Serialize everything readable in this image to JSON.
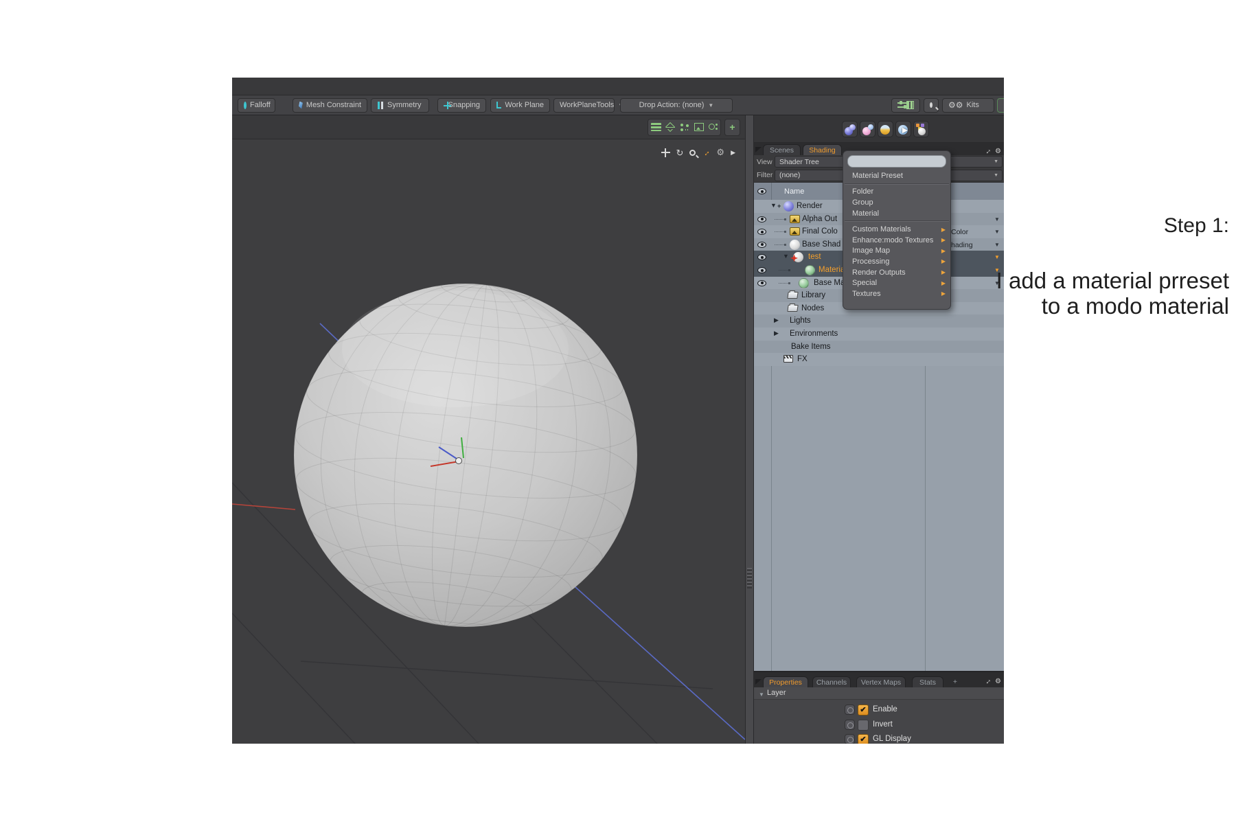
{
  "annotation": {
    "step": "Step 1:",
    "line1": "I add a material prreset",
    "line2": "to a modo material"
  },
  "toolbar": {
    "buttons": [
      {
        "label": "Falloff",
        "icon": "falloff-icon"
      },
      {
        "label": "Mesh Constraint",
        "icon": "mesh-constraint-icon"
      },
      {
        "label": "Symmetry",
        "icon": "symmetry-icon"
      },
      {
        "label": "Snapping",
        "icon": "snapping-icon"
      },
      {
        "label": "Work Plane",
        "icon": "work-plane-icon"
      },
      {
        "label": "WorkPlaneTools",
        "icon": "none"
      }
    ],
    "drop_action_label": "Drop Action: (none)",
    "kits_label": "Kits"
  },
  "shading_panel": {
    "tabs": [
      {
        "label": "Scenes",
        "active": false
      },
      {
        "label": "Shading",
        "active": true
      }
    ],
    "view_label": "View",
    "view_value": "Shader Tree",
    "filter_label": "Filter",
    "filter_value": "(none)",
    "name_column": "Name",
    "tree": [
      {
        "label": "Render",
        "icon": "sphere-purple",
        "eye": false,
        "expander": "down-plus",
        "selected": false,
        "effect": "",
        "effect_arrow": false
      },
      {
        "label": "Alpha Out",
        "icon": "image-map",
        "eye": true,
        "expander": "none",
        "selected": false,
        "effect": "",
        "effect_arrow": true
      },
      {
        "label": "Final Colo",
        "icon": "image-map",
        "eye": true,
        "expander": "none",
        "selected": false,
        "effect": "Color",
        "effect_arrow": true
      },
      {
        "label": "Base Shad",
        "icon": "sphere-white",
        "eye": true,
        "expander": "none",
        "selected": false,
        "effect": "hading",
        "effect_arrow": true
      },
      {
        "label": "test",
        "icon": "sphere-star",
        "eye": true,
        "expander": "down",
        "selected": true,
        "effect": "",
        "effect_arrow": true
      },
      {
        "label": "Materia",
        "icon": "sphere-green",
        "eye": true,
        "expander": "none",
        "selected": true,
        "effect": "",
        "effect_arrow": true
      },
      {
        "label": "Base Mate",
        "icon": "sphere-green",
        "eye": true,
        "expander": "none",
        "selected": false,
        "effect": "",
        "effect_arrow": true
      },
      {
        "label": "Library",
        "icon": "folder",
        "eye": false,
        "expander": "none",
        "selected": false,
        "effect": "",
        "effect_arrow": false
      },
      {
        "label": "Nodes",
        "icon": "folder",
        "eye": false,
        "expander": "none",
        "selected": false,
        "effect": "",
        "effect_arrow": false
      },
      {
        "label": "Lights",
        "icon": "none",
        "eye": false,
        "expander": "right",
        "selected": false,
        "effect": "",
        "effect_arrow": false
      },
      {
        "label": "Environments",
        "icon": "none",
        "eye": false,
        "expander": "right",
        "selected": false,
        "effect": "",
        "effect_arrow": false
      },
      {
        "label": "Bake Items",
        "icon": "none",
        "eye": false,
        "expander": "none",
        "selected": false,
        "effect": "",
        "effect_arrow": false
      },
      {
        "label": "FX",
        "icon": "clapperboard",
        "eye": false,
        "expander": "none",
        "selected": false,
        "effect": "",
        "effect_arrow": false
      }
    ]
  },
  "add_layer_menu": {
    "search_value": "",
    "items": [
      {
        "label": "Material Preset",
        "submenu": false
      },
      {
        "separator": true
      },
      {
        "label": "Folder",
        "submenu": false
      },
      {
        "label": "Group",
        "submenu": false
      },
      {
        "label": "Material",
        "submenu": false
      },
      {
        "separator": true
      },
      {
        "label": "Custom Materials",
        "submenu": true
      },
      {
        "label": "Enhance:modo Textures",
        "submenu": true
      },
      {
        "label": "Image Map",
        "submenu": true
      },
      {
        "label": "Processing",
        "submenu": true
      },
      {
        "label": "Render Outputs",
        "submenu": true
      },
      {
        "label": "Special",
        "submenu": true
      },
      {
        "label": "Textures",
        "submenu": true
      }
    ]
  },
  "properties_panel": {
    "tabs": [
      {
        "label": "Properties",
        "active": true
      },
      {
        "label": "Channels",
        "active": false
      },
      {
        "label": "Vertex Maps",
        "active": false
      },
      {
        "label": "Stats",
        "active": false
      },
      {
        "label": "+",
        "active": false
      }
    ],
    "section": "Layer",
    "rows": [
      {
        "label": "Enable",
        "checked": true
      },
      {
        "label": "Invert",
        "checked": false
      },
      {
        "label": "GL Display",
        "checked": true
      }
    ]
  },
  "colors": {
    "accent_orange": "#f09b2d",
    "selection_row": "#4d555e",
    "checkbox_orange": "#e9a03a",
    "icon_green": "#8dcb7e",
    "icon_teal": "#3ec6d0"
  }
}
